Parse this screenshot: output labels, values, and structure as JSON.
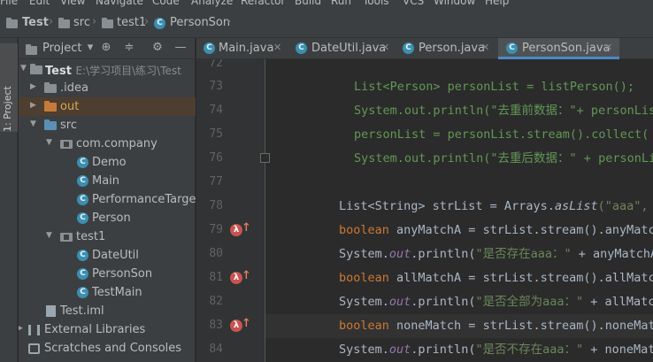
{
  "menu": [
    "File",
    "Edit",
    "View",
    "Navigate",
    "Code",
    "Analyze",
    "Refactor",
    "Build",
    "Run",
    "Tools",
    "VCS",
    "Window",
    "Help"
  ],
  "breadcrumb": {
    "project": "Test",
    "src": "src",
    "pkg": "test1",
    "file": "PersonSon"
  },
  "left_strip": {
    "label": "1: Project"
  },
  "project_panel": {
    "title": "Project",
    "tree": {
      "root": "Test",
      "root_path": "E:\\学习项目\\练习\\Test",
      "idea": ".idea",
      "out": "out",
      "src": "src",
      "com_company": "com.company",
      "demo": "Demo",
      "main": "Main",
      "performance": "PerformanceTarget",
      "person": "Person",
      "test1": "test1",
      "dateutil": "DateUtil",
      "personson": "PersonSon",
      "testmain": "TestMain",
      "iml": "Test.iml",
      "external": "External Libraries",
      "scratches": "Scratches and Consoles"
    }
  },
  "tabs": [
    "Main.java",
    "DateUtil.java",
    "Person.java",
    "PersonSon.java"
  ],
  "active_tab": "PersonSon.java",
  "gutter": {
    "lines": [
      "72",
      "73",
      "74",
      "75",
      "76",
      "77",
      "78",
      "79",
      "80",
      "81",
      "82",
      "83",
      "84"
    ]
  },
  "code": {
    "c73": "List<Person> personList = listPerson();",
    "c74": "System.out.println(\"去重前数据：\"+ personList);",
    "c75": "personList = personList.stream().collect(",
    "c76": "System.out.println(\"去重后数据：\" + personList);",
    "l78a": "List<String> strList = Arrays.",
    "l78b": "asList",
    "l78c": "(\"aaa\", \"bbb\");",
    "l79kw": "boolean",
    "l79": " anyMatchA = strList.stream().anyMatch(",
    "l80a": "System.",
    "l80b": "out",
    "l80c": ".println(",
    "l80d": "\"是否存在aaa：\"",
    "l80e": " + anyMatchA);",
    "l81kw": "boolean",
    "l81": " allMatchA = strList.stream().allMatch(",
    "l82a": "System.",
    "l82b": "out",
    "l82c": ".println(",
    "l82d": "\"是否全部为aaa：\"",
    "l82e": " + allMatchA);",
    "l83kw": "boolean",
    "l83": " noneMatch = strList.stream().noneMatch(",
    "l84a": "System.",
    "l84b": "out",
    "l84c": ".println(",
    "l84d": "\"是否不存在aaa：\"",
    "l84e": " + noneMatch);",
    "comment": "//"
  },
  "colors": {
    "keyword": "#cc7832",
    "string": "#6a8759",
    "comment": "#808080",
    "static_field": "#9876aa",
    "tab_accent": "#4a88c7"
  }
}
